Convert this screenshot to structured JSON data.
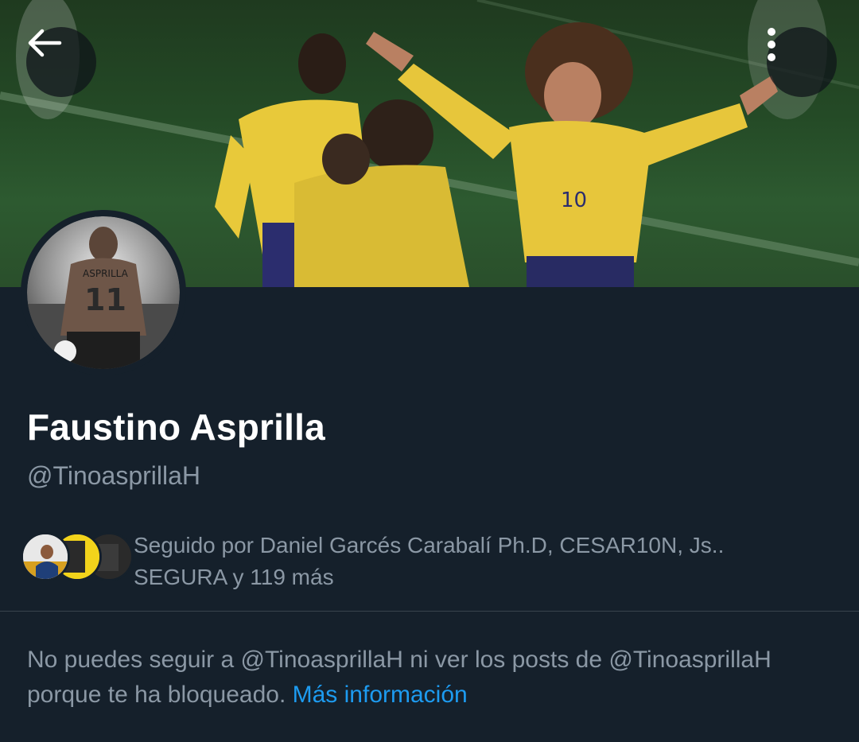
{
  "header": {
    "back_icon": "arrow-left-icon",
    "more_icon": "vertical-ellipsis-icon"
  },
  "banner": {
    "description_icon": "header-photo",
    "jersey_number": "10"
  },
  "avatar": {
    "jersey_name": "ASPRILLA",
    "jersey_number": "11"
  },
  "profile": {
    "display_name": "Faustino Asprilla",
    "handle": "@TinoasprillaH"
  },
  "followed_by": {
    "line1": "Seguido por Daniel Garcés Carabalí Ph.D, CESAR10N, Js..",
    "line2": "SEGURA y 119 más"
  },
  "blocked_notice": {
    "text": "No puedes seguir a @TinoasprillaH ni ver los posts de @TinoasprillaH porque te ha bloqueado. ",
    "link": "Más información"
  },
  "colors": {
    "background": "#15202b",
    "secondary_text": "#8b98a5",
    "accent": "#1d9bf0",
    "divider": "#38444d"
  }
}
